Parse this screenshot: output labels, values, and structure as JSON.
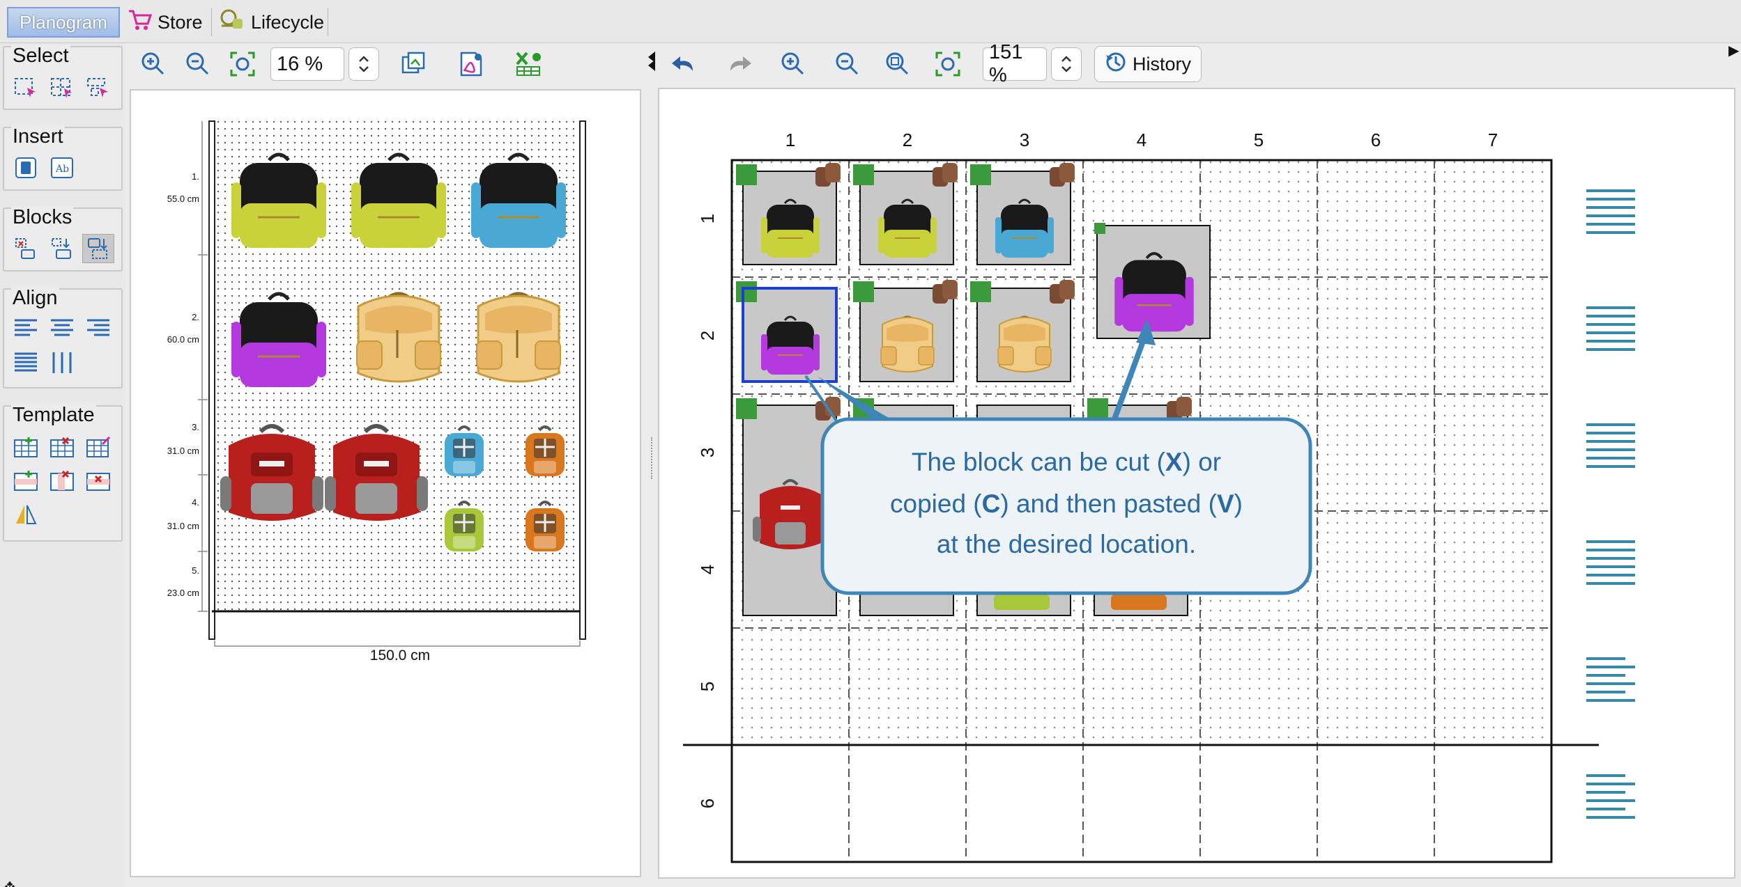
{
  "tabs": [
    {
      "label": "Planogram",
      "icon": "planogram-tab",
      "active": true
    },
    {
      "label": "Store",
      "icon": "cart-icon"
    },
    {
      "label": "Lifecycle",
      "icon": "lifecycle-icon"
    }
  ],
  "side_groups": [
    {
      "title": "Select",
      "icons": [
        "select-rect-icon",
        "select-grid-icon",
        "select-items-icon"
      ]
    },
    {
      "title": "Insert",
      "icons": [
        "insert-product-icon",
        "insert-text-icon"
      ]
    },
    {
      "title": "Blocks",
      "icons": [
        "block-remove-icon",
        "block-move-icon",
        "block-swap-icon"
      ]
    },
    {
      "title": "Align",
      "icons": [
        "align-left-icon",
        "align-center-icon",
        "align-right-icon",
        "align-justify-icon",
        "align-columns-icon"
      ]
    },
    {
      "title": "Template",
      "icons": [
        "template-add-icon",
        "template-delete-icon",
        "template-edit-icon",
        "template-add-row-icon",
        "template-delete-row-icon",
        "template-delete-col-icon",
        "mirror-icon"
      ]
    }
  ],
  "left_toolbar": {
    "zoom": "16 %",
    "buttons": [
      "zoom-in-icon",
      "zoom-out-icon",
      "fit-icon",
      "copy-view-icon",
      "export-pdf-icon",
      "export-excel-icon"
    ]
  },
  "right_toolbar": {
    "zoom": "151 %",
    "history_label": "History",
    "buttons": [
      "undo-icon",
      "redo-icon",
      "zoom-in-icon",
      "zoom-out-icon",
      "zoom-reset-icon",
      "fit-icon"
    ]
  },
  "wall": {
    "width_label": "150.0 cm",
    "shelves": [
      {
        "num": "1.",
        "height": "55.0 cm"
      },
      {
        "num": "2.",
        "height": "60.0 cm"
      },
      {
        "num": "3.",
        "height": "31.0 cm"
      },
      {
        "num": "4.",
        "height": "31.0 cm"
      },
      {
        "num": "5.",
        "height": "23.0 cm"
      }
    ]
  },
  "grid": {
    "columns": [
      "1",
      "2",
      "3",
      "4",
      "5",
      "6",
      "7"
    ],
    "rows": [
      "1",
      "2",
      "3",
      "4",
      "5",
      "6"
    ]
  },
  "callout": {
    "line1_a": "The block can be cut (",
    "line1_key": "X",
    "line1_b": ") or",
    "line2_a": "copied (",
    "line2_key1": "C",
    "line2_b": ") and then pasted (",
    "line2_key2": "V",
    "line2_c": ")",
    "line3": "at the desired location."
  },
  "colors": {
    "yellow_bag": "#c9d23a",
    "blue_bag": "#4aa8d4",
    "purple_bag": "#b43ae0",
    "tan_bag": "#e8c06a",
    "red_bag": "#b8201e",
    "orange_bag": "#d9771e",
    "green_handle": "#3c9a3c",
    "callout_border": "#3f86b8",
    "callout_fill": "#eef3f8",
    "callout_text": "#2a6aa0",
    "selection": "#1c3dd6"
  }
}
